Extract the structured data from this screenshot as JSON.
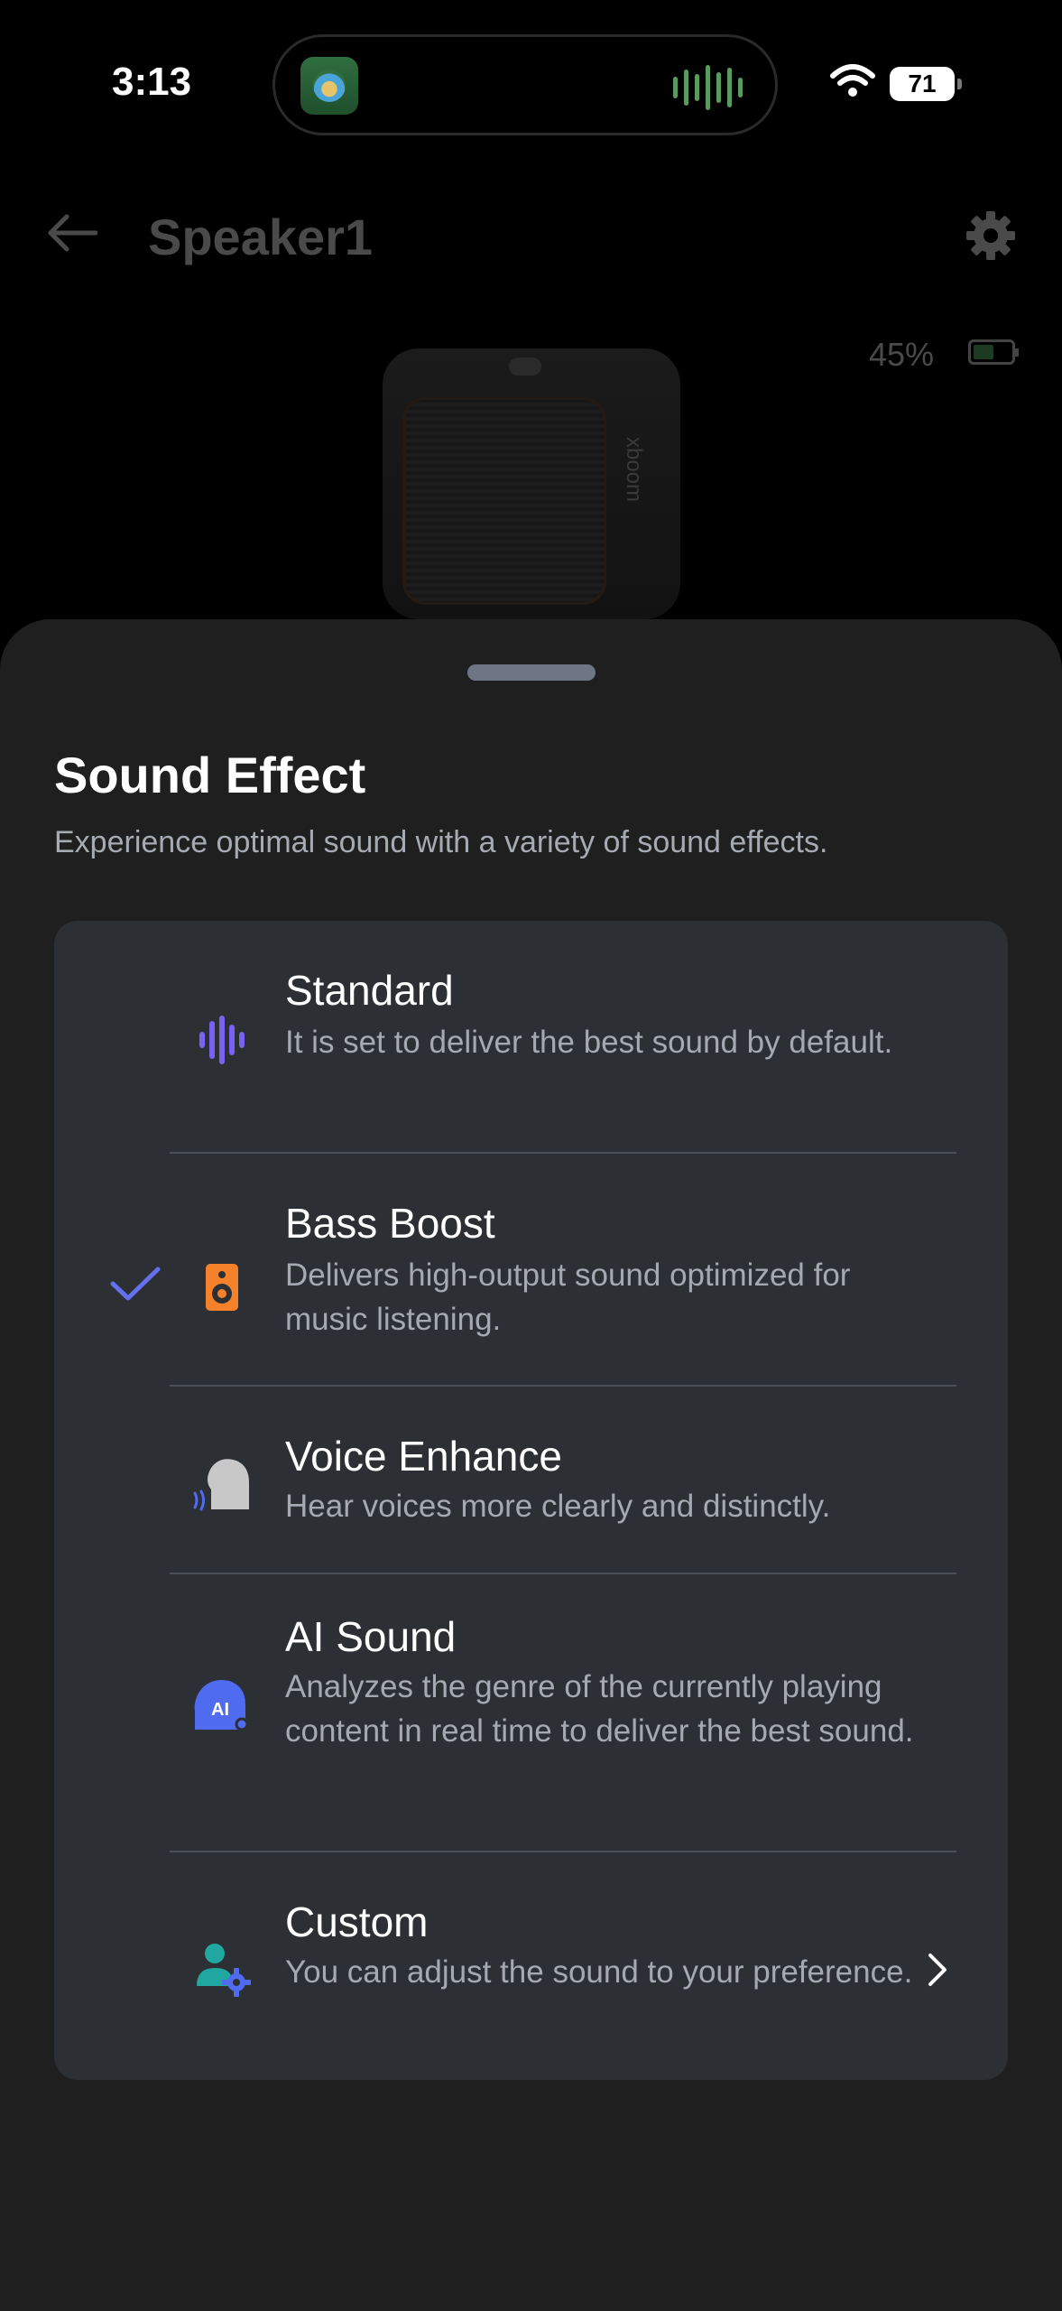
{
  "status": {
    "time": "3:13",
    "battery": "71"
  },
  "header": {
    "title": "Speaker1",
    "battery_level": "45%"
  },
  "speaker_image": {
    "brand": "xboom"
  },
  "sheet": {
    "title": "Sound Effect",
    "subtitle": "Experience optimal sound with a variety of sound effects.",
    "selected": "Bass Boost",
    "options": [
      {
        "title": "Standard",
        "description": "It is set to deliver the best sound by default.",
        "icon": "waveform-icon",
        "color": "#7a62f0"
      },
      {
        "title": "Bass Boost",
        "description": "Delivers high-output sound optimized for music listening.",
        "icon": "speaker-icon",
        "color": "#f5822a"
      },
      {
        "title": "Voice Enhance",
        "description": "Hear voices more clearly and distinctly.",
        "icon": "voice-head-icon",
        "color": "#c8c8c8"
      },
      {
        "title": "AI Sound",
        "description": "Analyzes the genre of the currently playing content in real time to deliver the best sound.",
        "icon": "ai-head-icon",
        "color": "#4f6bf0"
      },
      {
        "title": "Custom",
        "description": "You can adjust the sound to your preference.",
        "icon": "user-settings-icon",
        "color": "#1fa7a0"
      }
    ]
  },
  "colors": {
    "check": "#6470f0",
    "accent_purple": "#7a62f0"
  }
}
